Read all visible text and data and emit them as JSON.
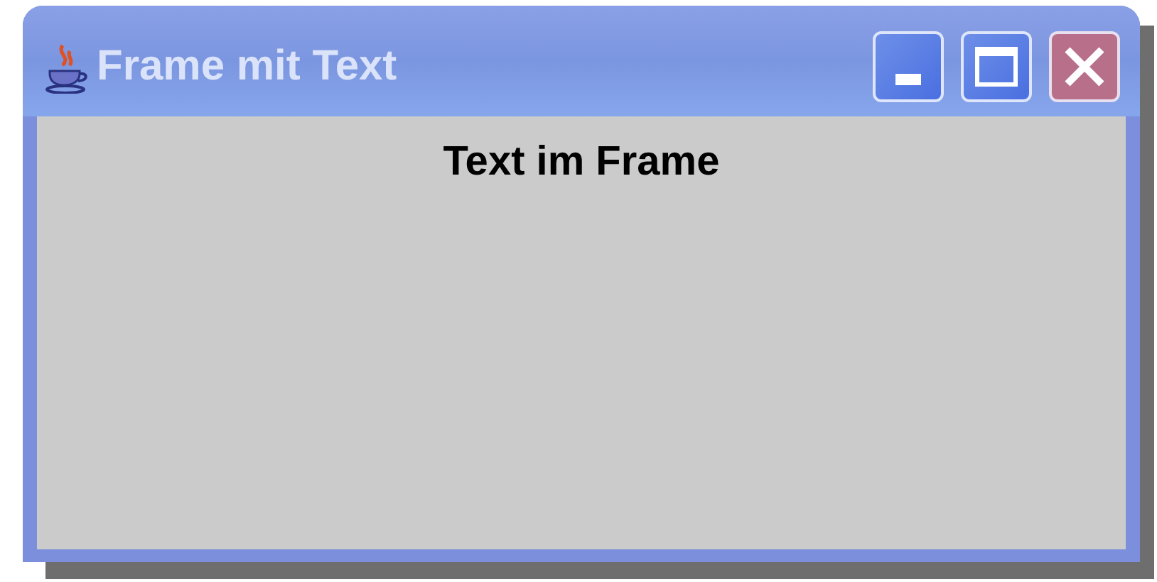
{
  "window": {
    "title": "Frame mit Text"
  },
  "content": {
    "label": "Text im Frame"
  }
}
